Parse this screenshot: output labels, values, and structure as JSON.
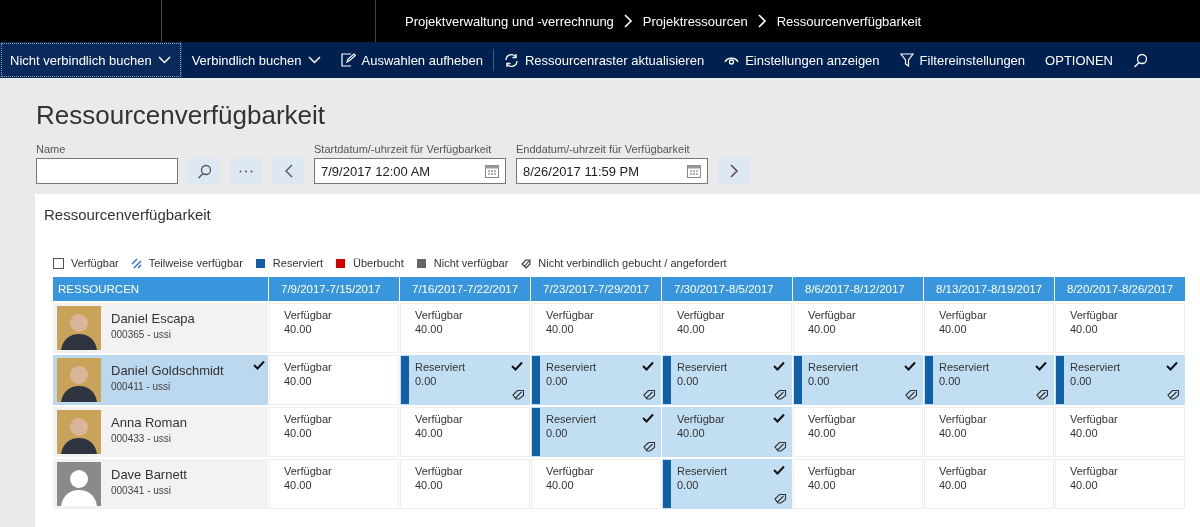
{
  "breadcrumb": [
    "Projektverwaltung und -verrechnung",
    "Projektressourcen",
    "Ressourcenverfügbarkeit"
  ],
  "toolbar": [
    {
      "label": "Nicht verbindlich buchen",
      "kind": "dropdown",
      "focused": true
    },
    {
      "label": "Verbindlich buchen",
      "kind": "dropdown",
      "focused": false
    },
    {
      "label": "Auswahlen aufheben",
      "kind": "clear",
      "focused": false
    },
    {
      "label": "Ressourcenraster aktualisieren",
      "kind": "refresh",
      "focused": false
    },
    {
      "label": "Einstellungen anzeigen",
      "kind": "view",
      "focused": false
    },
    {
      "label": "Filtereinstellungen",
      "kind": "filter",
      "focused": false
    },
    {
      "label": "OPTIONEN",
      "kind": "plain",
      "focused": false
    },
    {
      "kind": "search",
      "focused": false
    }
  ],
  "page_title": "Ressourcenverfügbarkeit",
  "filters": {
    "name": {
      "label": "Name"
    },
    "start": {
      "label": "Startdatum/-uhrzeit für Verfügbarkeit",
      "value": "7/9/2017 12:00 AM"
    },
    "end": {
      "label": "Enddatum/-uhrzeit für Verfügbarkeit",
      "value": "8/26/2017 11:59 PM"
    }
  },
  "panel_title": "Ressourcenverfügbarkeit",
  "legend": [
    {
      "label": "Verfügbar",
      "kind": "available"
    },
    {
      "label": "Teilweise verfügbar",
      "kind": "partial"
    },
    {
      "label": "Reserviert",
      "kind": "reserved"
    },
    {
      "label": "Überbucht",
      "kind": "overbooked"
    },
    {
      "label": "Nicht verfügbar",
      "kind": "unavailable"
    },
    {
      "label": "Nicht verbindlich gebucht / angefordert",
      "kind": "softbook"
    }
  ],
  "grid": {
    "resource_header": "RESSOURCEN",
    "periods": [
      "7/9/2017-7/15/2017",
      "7/16/2017-7/22/2017",
      "7/23/2017-7/29/2017",
      "7/30/2017-8/5/2017",
      "8/6/2017-8/12/2017",
      "8/13/2017-8/19/2017",
      "8/20/2017-8/26/2017"
    ],
    "rows": [
      {
        "name": "Daniel Escapa",
        "id": "000365 - ussi",
        "photo": true,
        "selected": false,
        "cells": [
          {
            "status": "Verfügbar",
            "hours": "40.00",
            "kind": "available",
            "selected": false,
            "soft_booked": false
          },
          {
            "status": "Verfügbar",
            "hours": "40.00",
            "kind": "available",
            "selected": false,
            "soft_booked": false
          },
          {
            "status": "Verfügbar",
            "hours": "40.00",
            "kind": "available",
            "selected": false,
            "soft_booked": false
          },
          {
            "status": "Verfügbar",
            "hours": "40.00",
            "kind": "available",
            "selected": false,
            "soft_booked": false
          },
          {
            "status": "Verfügbar",
            "hours": "40.00",
            "kind": "available",
            "selected": false,
            "soft_booked": false
          },
          {
            "status": "Verfügbar",
            "hours": "40.00",
            "kind": "available",
            "selected": false,
            "soft_booked": false
          },
          {
            "status": "Verfügbar",
            "hours": "40.00",
            "kind": "available",
            "selected": false,
            "soft_booked": false
          }
        ]
      },
      {
        "name": "Daniel Goldschmidt",
        "id": "000411 - ussi",
        "photo": true,
        "selected": true,
        "cells": [
          {
            "status": "Verfügbar",
            "hours": "40.00",
            "kind": "available",
            "selected": false,
            "soft_booked": false
          },
          {
            "status": "Reserviert",
            "hours": "0.00",
            "kind": "reserved",
            "selected": true,
            "soft_booked": true
          },
          {
            "status": "Reserviert",
            "hours": "0.00",
            "kind": "reserved",
            "selected": true,
            "soft_booked": true
          },
          {
            "status": "Reserviert",
            "hours": "0.00",
            "kind": "reserved",
            "selected": true,
            "soft_booked": true
          },
          {
            "status": "Reserviert",
            "hours": "0.00",
            "kind": "reserved",
            "selected": true,
            "soft_booked": true
          },
          {
            "status": "Reserviert",
            "hours": "0.00",
            "kind": "reserved",
            "selected": true,
            "soft_booked": true
          },
          {
            "status": "Reserviert",
            "hours": "0.00",
            "kind": "reserved",
            "selected": true,
            "soft_booked": true
          }
        ]
      },
      {
        "name": "Anna Roman",
        "id": "000433 - ussi",
        "photo": true,
        "selected": false,
        "cells": [
          {
            "status": "Verfügbar",
            "hours": "40.00",
            "kind": "available",
            "selected": false,
            "soft_booked": false
          },
          {
            "status": "Verfügbar",
            "hours": "40.00",
            "kind": "available",
            "selected": false,
            "soft_booked": false
          },
          {
            "status": "Reserviert",
            "hours": "0.00",
            "kind": "reserved",
            "selected": true,
            "soft_booked": true
          },
          {
            "status": "Verfügbar",
            "hours": "40.00",
            "kind": "available",
            "selected": true,
            "soft_booked": true
          },
          {
            "status": "Verfügbar",
            "hours": "40.00",
            "kind": "available",
            "selected": false,
            "soft_booked": false
          },
          {
            "status": "Verfügbar",
            "hours": "40.00",
            "kind": "available",
            "selected": false,
            "soft_booked": false
          },
          {
            "status": "Verfügbar",
            "hours": "40.00",
            "kind": "available",
            "selected": false,
            "soft_booked": false
          }
        ]
      },
      {
        "name": "Dave Barnett",
        "id": "000341 - ussi",
        "photo": false,
        "selected": false,
        "cells": [
          {
            "status": "Verfügbar",
            "hours": "40.00",
            "kind": "available",
            "selected": false,
            "soft_booked": false
          },
          {
            "status": "Verfügbar",
            "hours": "40.00",
            "kind": "available",
            "selected": false,
            "soft_booked": false
          },
          {
            "status": "Verfügbar",
            "hours": "40.00",
            "kind": "available",
            "selected": false,
            "soft_booked": false
          },
          {
            "status": "Reserviert",
            "hours": "0.00",
            "kind": "reserved",
            "selected": true,
            "soft_booked": true
          },
          {
            "status": "Verfügbar",
            "hours": "40.00",
            "kind": "available",
            "selected": false,
            "soft_booked": false
          },
          {
            "status": "Verfügbar",
            "hours": "40.00",
            "kind": "available",
            "selected": false,
            "soft_booked": false
          },
          {
            "status": "Verfügbar",
            "hours": "40.00",
            "kind": "available",
            "selected": false,
            "soft_booked": false
          }
        ]
      }
    ]
  }
}
